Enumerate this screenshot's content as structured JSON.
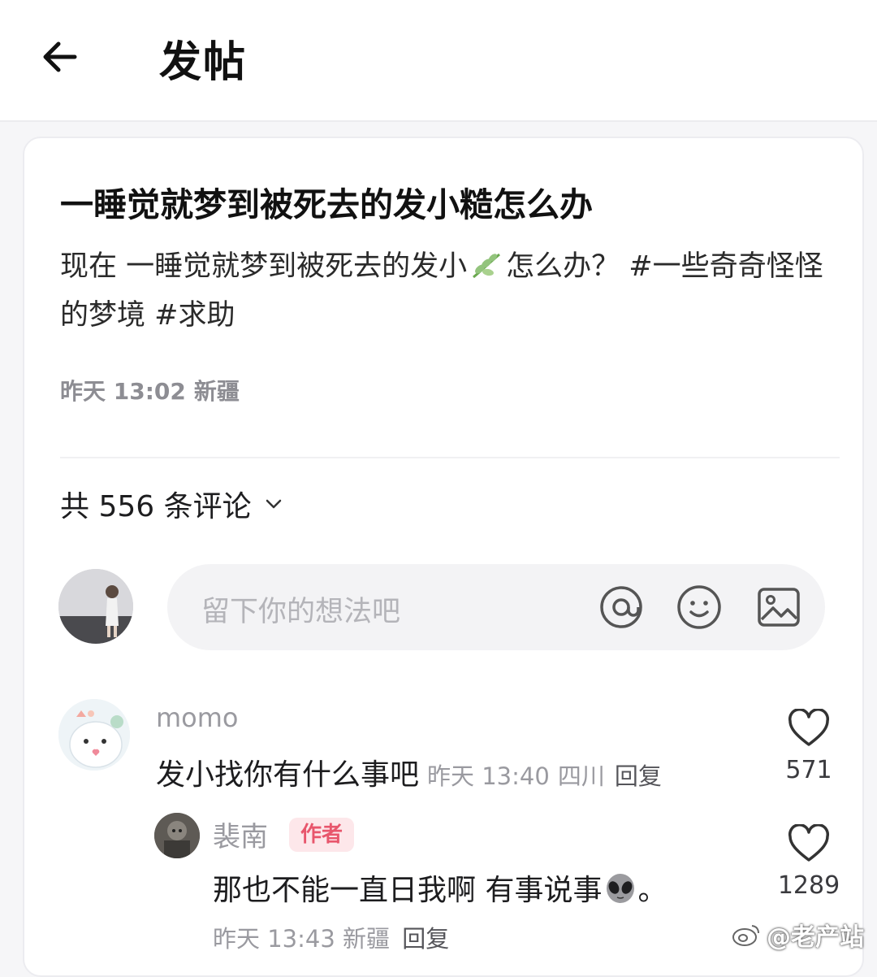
{
  "header": {
    "title": "发帖"
  },
  "post": {
    "title": "一睡觉就梦到被死去的发小糙怎么办",
    "body_before_emoji": "现在 一睡觉就梦到被死去的发小",
    "body_after_emoji": "怎么办？ #一些奇奇怪怪的梦境 #求助",
    "emoji_icon": "herb-icon",
    "date": "昨天 13:02",
    "location": "新疆"
  },
  "comments_header": {
    "label": "共 556 条评论"
  },
  "composer": {
    "placeholder": "留下你的想法吧"
  },
  "comments": [
    {
      "username": "momo",
      "text": "发小找你有什么事吧",
      "time": "昨天 13:40",
      "location": "四川",
      "reply_label": "回复",
      "likes": "571",
      "replies": [
        {
          "username": "裴南",
          "badge": "作者",
          "text_before_emoji": "那也不能一直日我啊 有事说事",
          "emoji_icon": "alien-icon",
          "text_after_emoji": "。",
          "time": "昨天 13:43",
          "location": "新疆",
          "reply_label": "回复",
          "likes": "1289"
        }
      ]
    }
  ],
  "watermark": {
    "text": "@老产站"
  },
  "colors": {
    "accent_badge_bg": "#fde7ea",
    "accent_badge_text": "#e8566c",
    "muted_text": "#9a9aa0"
  }
}
